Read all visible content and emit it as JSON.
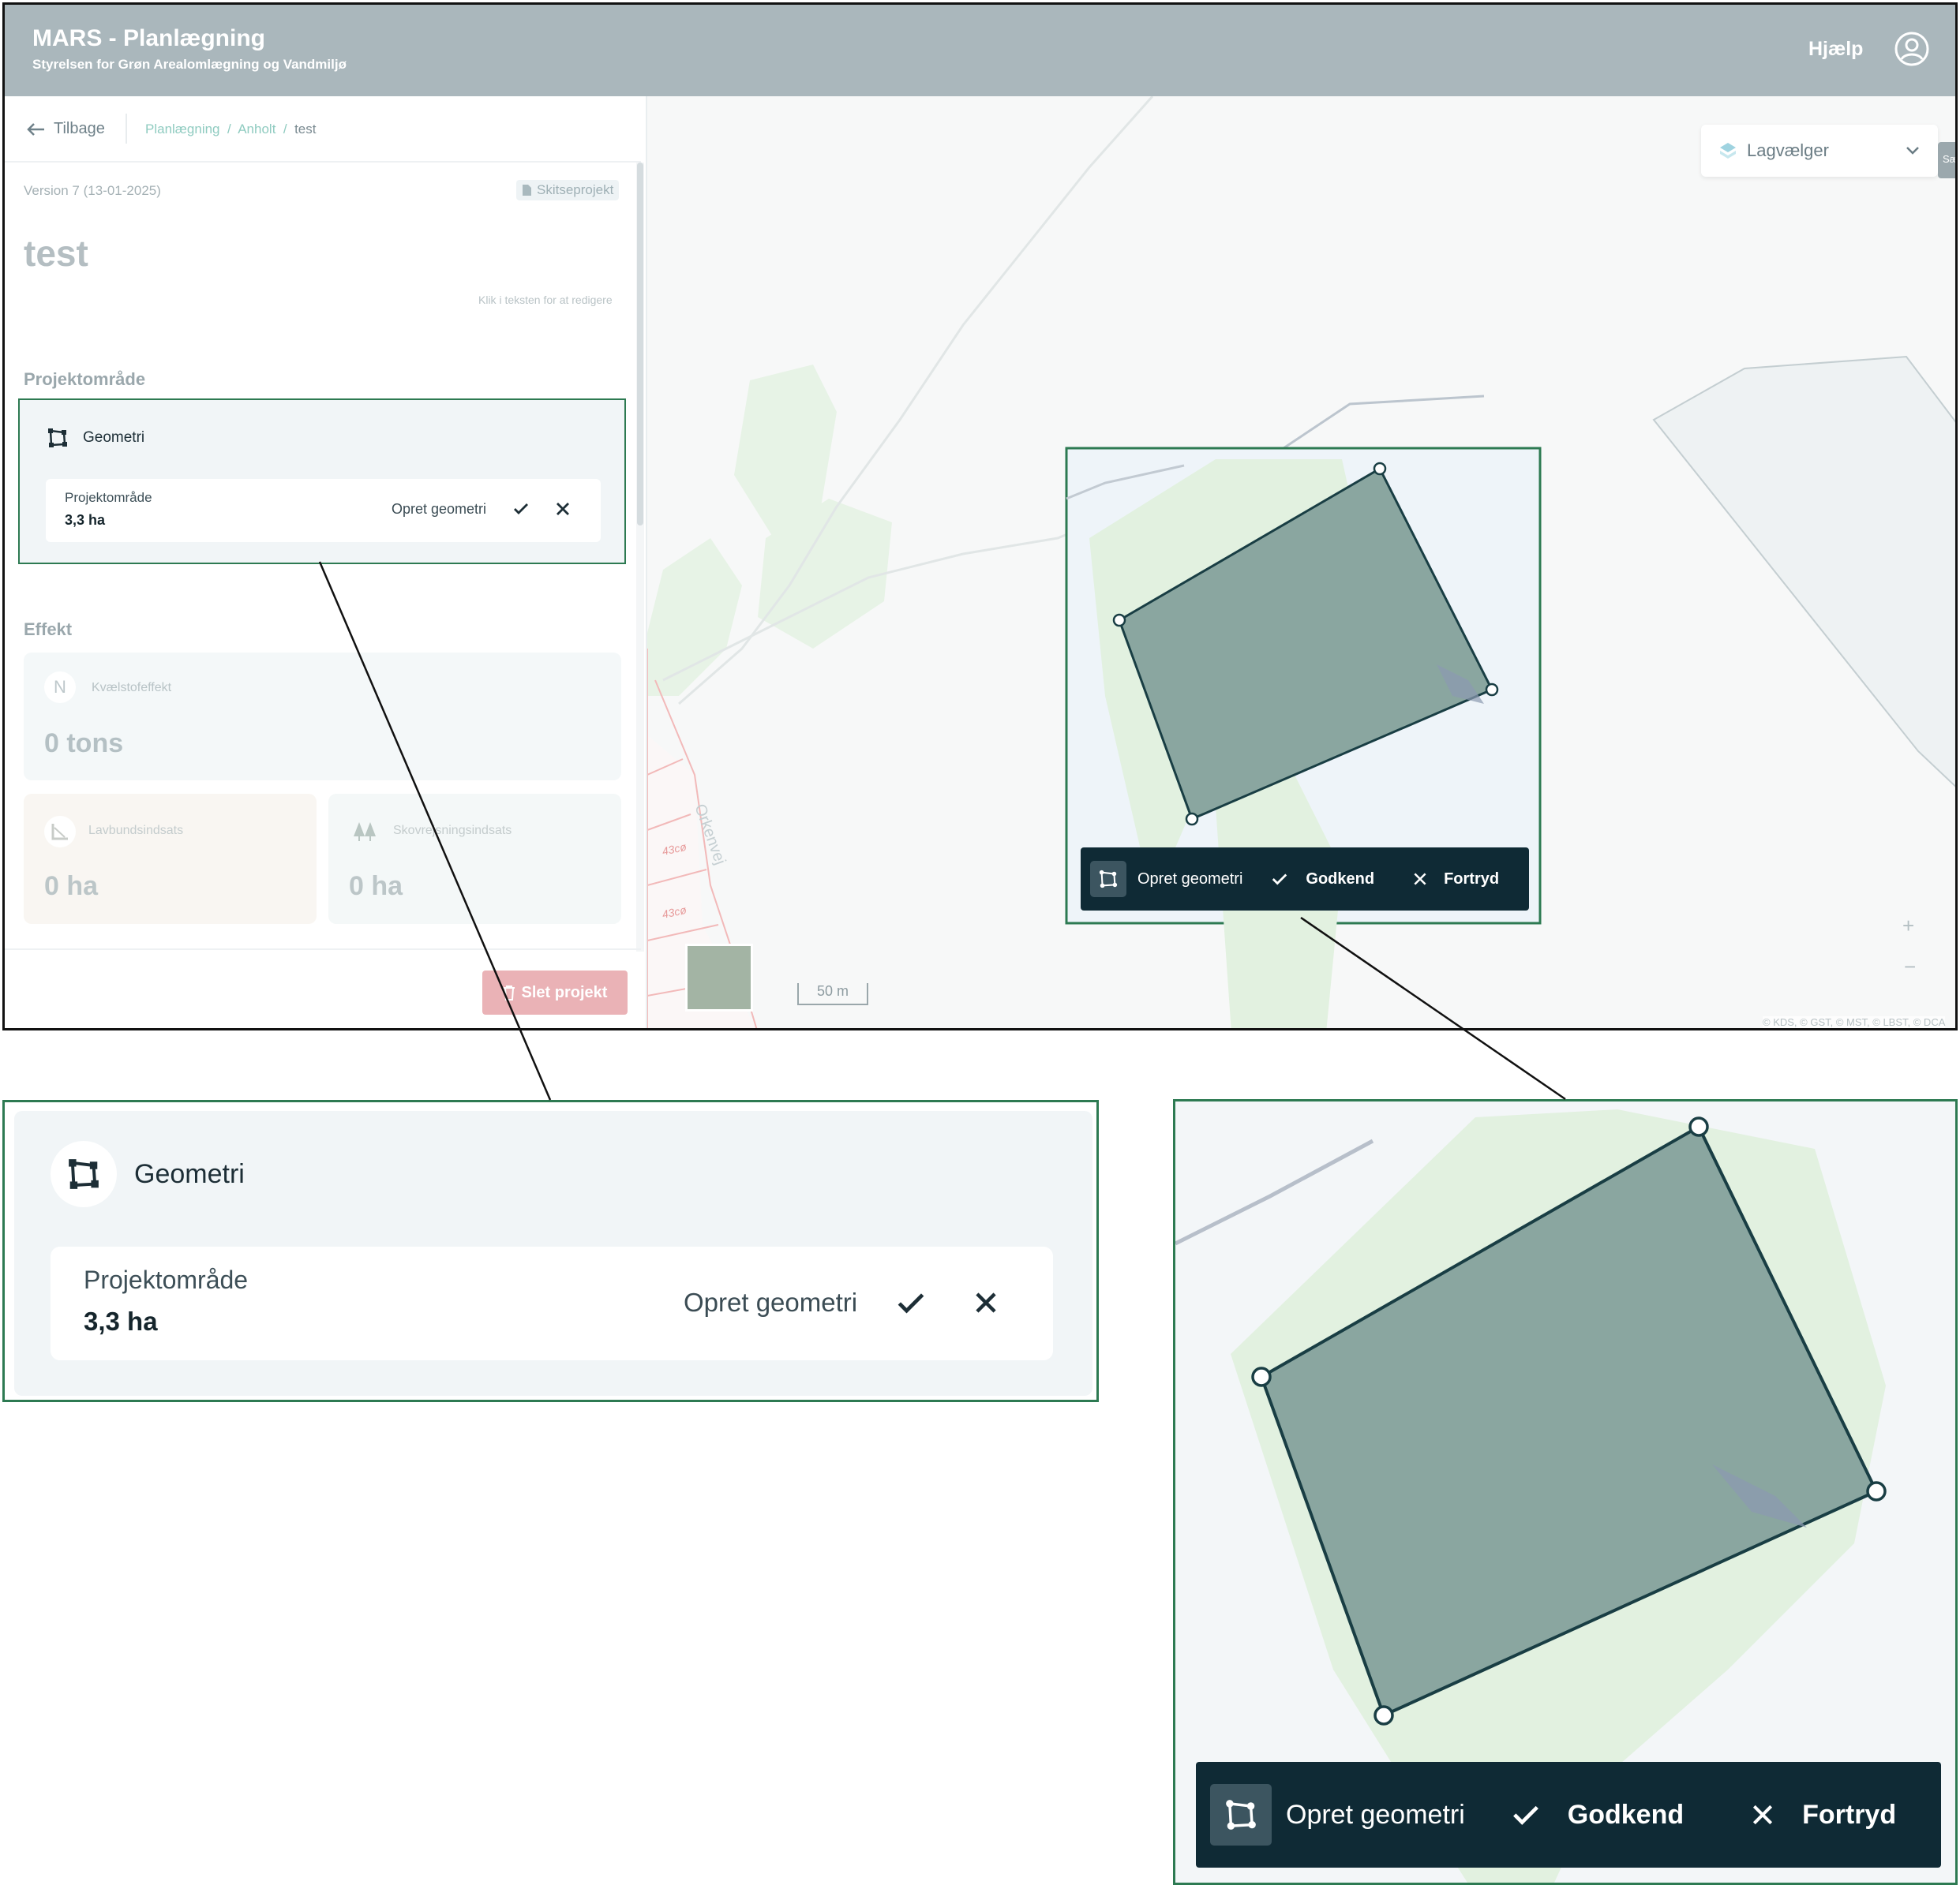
{
  "header": {
    "app_title": "MARS - Planlægning",
    "subtitle": "Styrelsen for Grøn Arealomlægning og Vandmiljø",
    "help_label": "Hjælp",
    "user_icon": "user-circle-icon"
  },
  "sidebar": {
    "back_label": "Tilbage",
    "breadcrumb": [
      "Planlægning",
      "Anholt",
      "test"
    ],
    "breadcrumb_sep": "/",
    "version": "Version 7 (13-01-2025)",
    "sketch_label": "Skitseprojekt",
    "project_title": "test",
    "edit_hint": "Klik i teksten for at redigere",
    "section_project_area": "Projektområde",
    "geometry": {
      "header_label": "Geometri",
      "area_label": "Projektområde",
      "area_value": "3,3 ha",
      "action_label": "Opret geometri"
    },
    "section_effect": "Effekt",
    "effects": {
      "nitrogen": {
        "icon_letter": "N",
        "label": "Kvælstofeffekt",
        "value": "0 tons"
      },
      "lowland": {
        "label": "Lavbundsindsats",
        "value": "0 ha"
      },
      "forest": {
        "label": "Skovrejsningsindsats",
        "value": "0 ha"
      }
    },
    "delete_label": "Slet projekt"
  },
  "map": {
    "layer_selector_label": "Lagvælger",
    "side_tab_label": "Sæ",
    "scale_label": "50 m",
    "zoom_in": "+",
    "zoom_out": "−",
    "attribution": "© KDS, © GST, © MST, © LBST, © DCA",
    "road_name": "Orkenvej",
    "parcel_labels": [
      "43cø",
      "43cø"
    ],
    "toolbar": {
      "create_label": "Opret geometri",
      "approve_label": "Godkend",
      "cancel_label": "Fortryd"
    }
  },
  "colors": {
    "header_bg": "#aab7bc",
    "toolbar_bg": "#0f2a35",
    "highlight_border": "#2d7a52",
    "polygon_fill": "#8aa6a0",
    "polygon_stroke": "#193e44",
    "delete_btn": "#eab2b6"
  }
}
